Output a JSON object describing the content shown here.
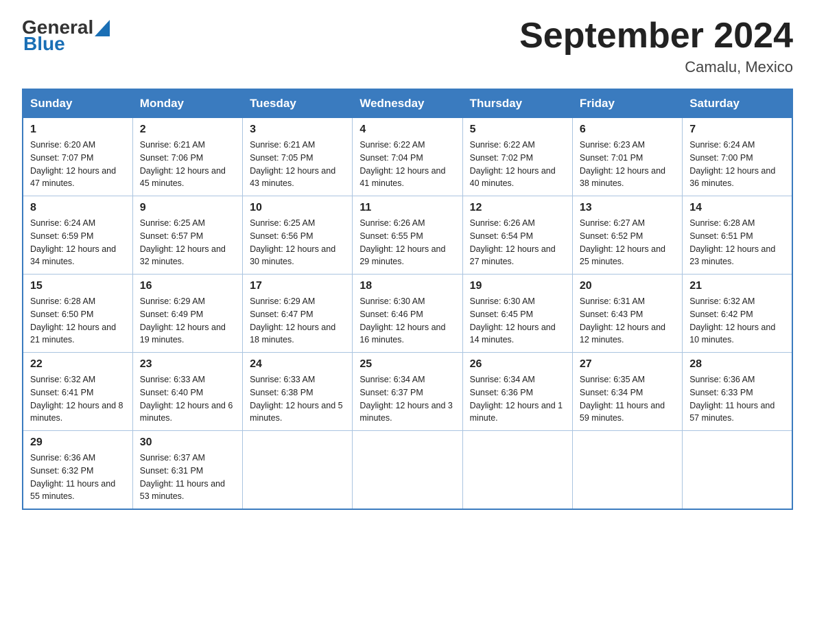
{
  "header": {
    "logo_general": "General",
    "logo_blue": "Blue",
    "month_title": "September 2024",
    "location": "Camalu, Mexico"
  },
  "weekdays": [
    "Sunday",
    "Monday",
    "Tuesday",
    "Wednesday",
    "Thursday",
    "Friday",
    "Saturday"
  ],
  "weeks": [
    [
      {
        "day": "1",
        "sunrise": "6:20 AM",
        "sunset": "7:07 PM",
        "daylight": "12 hours and 47 minutes."
      },
      {
        "day": "2",
        "sunrise": "6:21 AM",
        "sunset": "7:06 PM",
        "daylight": "12 hours and 45 minutes."
      },
      {
        "day": "3",
        "sunrise": "6:21 AM",
        "sunset": "7:05 PM",
        "daylight": "12 hours and 43 minutes."
      },
      {
        "day": "4",
        "sunrise": "6:22 AM",
        "sunset": "7:04 PM",
        "daylight": "12 hours and 41 minutes."
      },
      {
        "day": "5",
        "sunrise": "6:22 AM",
        "sunset": "7:02 PM",
        "daylight": "12 hours and 40 minutes."
      },
      {
        "day": "6",
        "sunrise": "6:23 AM",
        "sunset": "7:01 PM",
        "daylight": "12 hours and 38 minutes."
      },
      {
        "day": "7",
        "sunrise": "6:24 AM",
        "sunset": "7:00 PM",
        "daylight": "12 hours and 36 minutes."
      }
    ],
    [
      {
        "day": "8",
        "sunrise": "6:24 AM",
        "sunset": "6:59 PM",
        "daylight": "12 hours and 34 minutes."
      },
      {
        "day": "9",
        "sunrise": "6:25 AM",
        "sunset": "6:57 PM",
        "daylight": "12 hours and 32 minutes."
      },
      {
        "day": "10",
        "sunrise": "6:25 AM",
        "sunset": "6:56 PM",
        "daylight": "12 hours and 30 minutes."
      },
      {
        "day": "11",
        "sunrise": "6:26 AM",
        "sunset": "6:55 PM",
        "daylight": "12 hours and 29 minutes."
      },
      {
        "day": "12",
        "sunrise": "6:26 AM",
        "sunset": "6:54 PM",
        "daylight": "12 hours and 27 minutes."
      },
      {
        "day": "13",
        "sunrise": "6:27 AM",
        "sunset": "6:52 PM",
        "daylight": "12 hours and 25 minutes."
      },
      {
        "day": "14",
        "sunrise": "6:28 AM",
        "sunset": "6:51 PM",
        "daylight": "12 hours and 23 minutes."
      }
    ],
    [
      {
        "day": "15",
        "sunrise": "6:28 AM",
        "sunset": "6:50 PM",
        "daylight": "12 hours and 21 minutes."
      },
      {
        "day": "16",
        "sunrise": "6:29 AM",
        "sunset": "6:49 PM",
        "daylight": "12 hours and 19 minutes."
      },
      {
        "day": "17",
        "sunrise": "6:29 AM",
        "sunset": "6:47 PM",
        "daylight": "12 hours and 18 minutes."
      },
      {
        "day": "18",
        "sunrise": "6:30 AM",
        "sunset": "6:46 PM",
        "daylight": "12 hours and 16 minutes."
      },
      {
        "day": "19",
        "sunrise": "6:30 AM",
        "sunset": "6:45 PM",
        "daylight": "12 hours and 14 minutes."
      },
      {
        "day": "20",
        "sunrise": "6:31 AM",
        "sunset": "6:43 PM",
        "daylight": "12 hours and 12 minutes."
      },
      {
        "day": "21",
        "sunrise": "6:32 AM",
        "sunset": "6:42 PM",
        "daylight": "12 hours and 10 minutes."
      }
    ],
    [
      {
        "day": "22",
        "sunrise": "6:32 AM",
        "sunset": "6:41 PM",
        "daylight": "12 hours and 8 minutes."
      },
      {
        "day": "23",
        "sunrise": "6:33 AM",
        "sunset": "6:40 PM",
        "daylight": "12 hours and 6 minutes."
      },
      {
        "day": "24",
        "sunrise": "6:33 AM",
        "sunset": "6:38 PM",
        "daylight": "12 hours and 5 minutes."
      },
      {
        "day": "25",
        "sunrise": "6:34 AM",
        "sunset": "6:37 PM",
        "daylight": "12 hours and 3 minutes."
      },
      {
        "day": "26",
        "sunrise": "6:34 AM",
        "sunset": "6:36 PM",
        "daylight": "12 hours and 1 minute."
      },
      {
        "day": "27",
        "sunrise": "6:35 AM",
        "sunset": "6:34 PM",
        "daylight": "11 hours and 59 minutes."
      },
      {
        "day": "28",
        "sunrise": "6:36 AM",
        "sunset": "6:33 PM",
        "daylight": "11 hours and 57 minutes."
      }
    ],
    [
      {
        "day": "29",
        "sunrise": "6:36 AM",
        "sunset": "6:32 PM",
        "daylight": "11 hours and 55 minutes."
      },
      {
        "day": "30",
        "sunrise": "6:37 AM",
        "sunset": "6:31 PM",
        "daylight": "11 hours and 53 minutes."
      },
      null,
      null,
      null,
      null,
      null
    ]
  ]
}
